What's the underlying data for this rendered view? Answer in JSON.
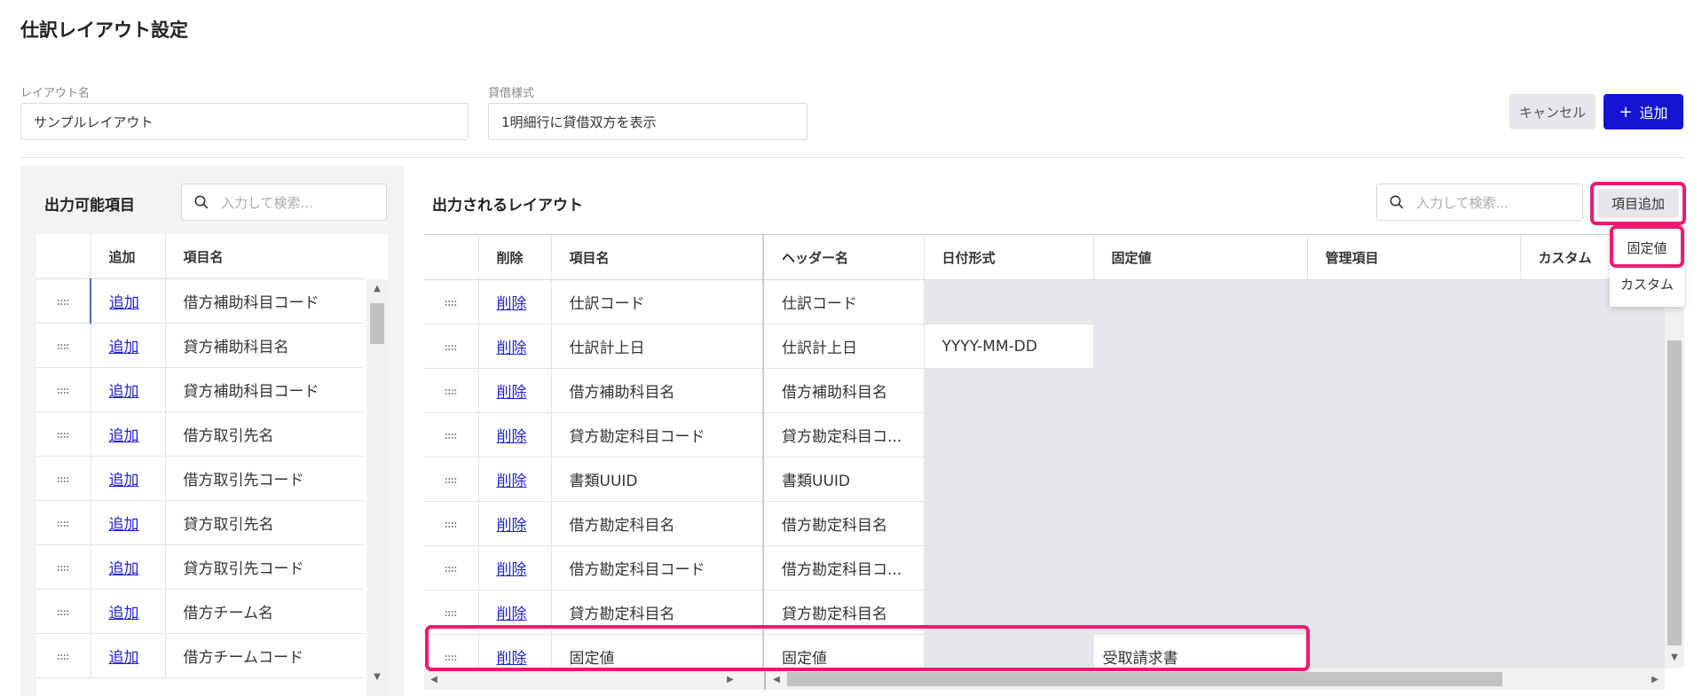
{
  "page": {
    "title": "仕訳レイアウト設定"
  },
  "form": {
    "layout_name_label": "レイアウト名",
    "layout_name_value": "サンプルレイアウト",
    "debit_credit_label": "貸借様式",
    "debit_credit_value": "1明細行に貸借双方を表示"
  },
  "header_actions": {
    "cancel": "キャンセル",
    "add_icon": "+",
    "add": "追加"
  },
  "available": {
    "title": "出力可能項目",
    "search_placeholder": "入力して検索...",
    "columns": [
      "追加",
      "項目名"
    ],
    "rows": [
      {
        "action": "追加",
        "name": "借方補助科目コード"
      },
      {
        "action": "追加",
        "name": "貸方補助科目名"
      },
      {
        "action": "追加",
        "name": "貸方補助科目コード"
      },
      {
        "action": "追加",
        "name": "借方取引先名"
      },
      {
        "action": "追加",
        "name": "借方取引先コード"
      },
      {
        "action": "追加",
        "name": "貸方取引先名"
      },
      {
        "action": "追加",
        "name": "貸方取引先コード"
      },
      {
        "action": "追加",
        "name": "借方チーム名"
      },
      {
        "action": "追加",
        "name": "借方チームコード"
      }
    ]
  },
  "output": {
    "title": "出力されるレイアウト",
    "search_placeholder": "入力して検索...",
    "add_item_button": "項目追加",
    "dropdown": [
      "固定値",
      "カスタム"
    ],
    "columns": [
      "削除",
      "項目名",
      "ヘッダー名",
      "日付形式",
      "固定値",
      "管理項目",
      "カスタム"
    ],
    "rows": [
      {
        "action": "削除",
        "item": "仕訳コード",
        "header": "仕訳コード",
        "date_format": "",
        "fixed": ""
      },
      {
        "action": "削除",
        "item": "仕訳計上日",
        "header": "仕訳計上日",
        "date_format": "YYYY-MM-DD",
        "fixed": ""
      },
      {
        "action": "削除",
        "item": "借方補助科目名",
        "header": "借方補助科目名",
        "date_format": "",
        "fixed": ""
      },
      {
        "action": "削除",
        "item": "貸方勘定科目コード",
        "header": "貸方勘定科目コ...",
        "date_format": "",
        "fixed": ""
      },
      {
        "action": "削除",
        "item": "書類UUID",
        "header": "書類UUID",
        "date_format": "",
        "fixed": ""
      },
      {
        "action": "削除",
        "item": "借方勘定科目名",
        "header": "借方勘定科目名",
        "date_format": "",
        "fixed": ""
      },
      {
        "action": "削除",
        "item": "借方勘定科目コード",
        "header": "借方勘定科目コ...",
        "date_format": "",
        "fixed": ""
      },
      {
        "action": "削除",
        "item": "貸方勘定科目名",
        "header": "貸方勘定科目名",
        "date_format": "",
        "fixed": ""
      },
      {
        "action": "削除",
        "item": "固定値",
        "header": "固定値",
        "date_format": "",
        "fixed": "受取請求書"
      }
    ]
  },
  "icons": {
    "search": "search-icon",
    "drag": "drag-handle-icon",
    "plus": "plus-icon"
  },
  "colors": {
    "primary": "#1414d2",
    "highlight": "#f0196e",
    "link": "#2424d0",
    "disabled_cell": "#e6e7ea"
  }
}
